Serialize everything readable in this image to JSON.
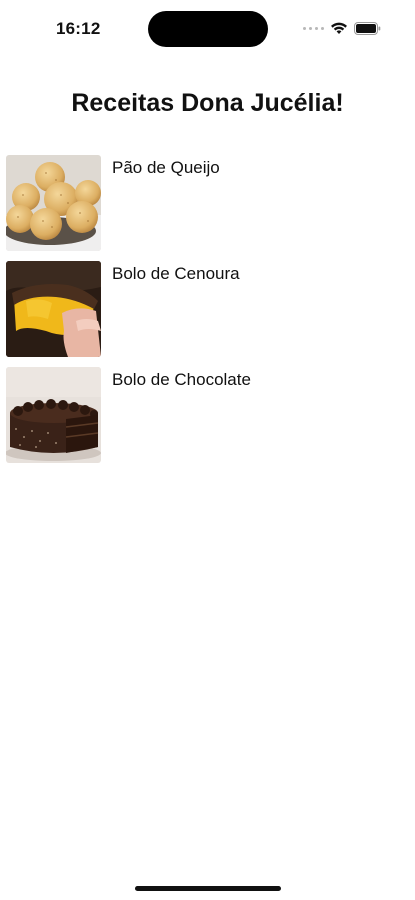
{
  "status_bar": {
    "time": "16:12",
    "icons": [
      "signal-dots-icon",
      "wifi-icon",
      "battery-icon"
    ]
  },
  "header": {
    "title": "Receitas Dona Jucélia!"
  },
  "recipes": [
    {
      "name": "Pão de Queijo",
      "image": "pao-de-queijo-photo"
    },
    {
      "name": "Bolo de Cenoura",
      "image": "bolo-de-cenoura-photo"
    },
    {
      "name": "Bolo de Chocolate",
      "image": "bolo-de-chocolate-photo"
    }
  ]
}
